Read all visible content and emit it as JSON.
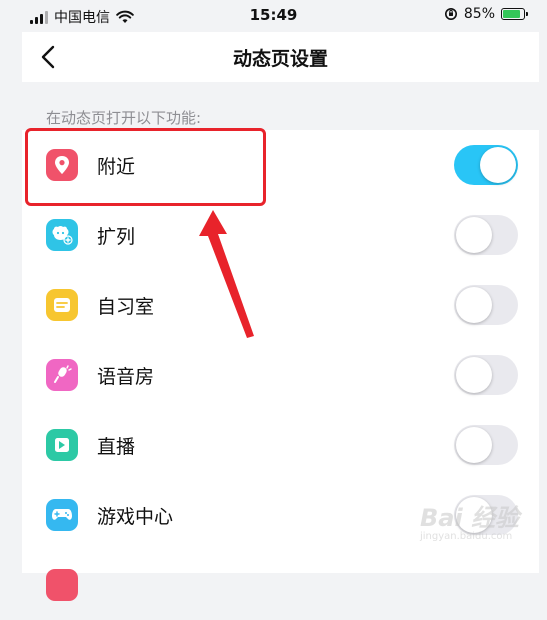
{
  "status_bar": {
    "carrier": "中国电信",
    "time": "15:49",
    "battery": "85%",
    "battery_level": 0.85
  },
  "nav": {
    "title": "动态页设置",
    "back_icon": "chevron-left-icon"
  },
  "section": {
    "header": "在动态页打开以下功能:"
  },
  "items": [
    {
      "label": "附近",
      "icon": "location-pin-icon",
      "icon_color": "#f0526a",
      "enabled": true
    },
    {
      "label": "扩列",
      "icon": "add-friend-icon",
      "icon_color": "#2fc4e6",
      "enabled": false
    },
    {
      "label": "自习室",
      "icon": "study-room-icon",
      "icon_color": "#f7c630",
      "enabled": false
    },
    {
      "label": "语音房",
      "icon": "microphone-icon",
      "icon_color": "#f067c3",
      "enabled": false
    },
    {
      "label": "直播",
      "icon": "live-icon",
      "icon_color": "#2cc9a5",
      "enabled": false
    },
    {
      "label": "游戏中心",
      "icon": "gamepad-icon",
      "icon_color": "#35b8f0",
      "enabled": false
    }
  ],
  "colors": {
    "toggle_on": "#29c5f6",
    "toggle_off": "#e9e9ee",
    "annotation": "#e8232b"
  },
  "watermark": {
    "text": "Bai 经验",
    "sub": "jingyan.baidu.com"
  }
}
